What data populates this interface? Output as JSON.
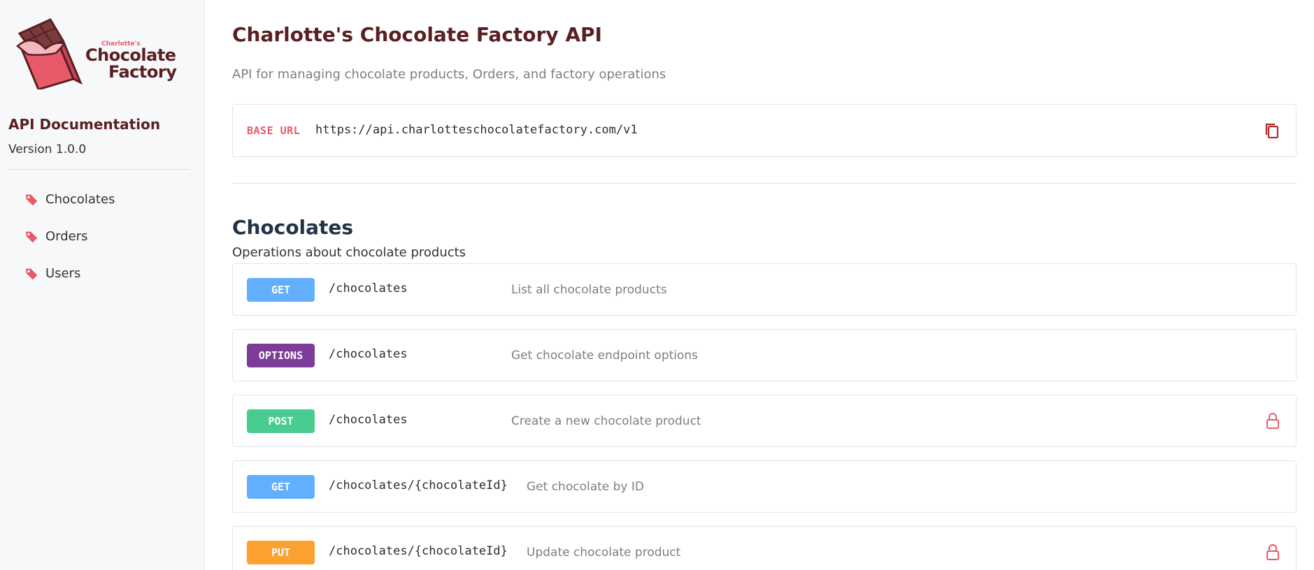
{
  "sidebar": {
    "logo": {
      "small": "Charlotte's",
      "line1": "Chocolate",
      "line2": "Factory"
    },
    "doc_title": "API Documentation",
    "version": "Version 1.0.0",
    "nav": [
      {
        "label": "Chocolates",
        "icon": "tag-icon"
      },
      {
        "label": "Orders",
        "icon": "tag-icon"
      },
      {
        "label": "Users",
        "icon": "tag-icon"
      }
    ]
  },
  "header": {
    "title": "Charlotte's Chocolate Factory API",
    "description": "API for managing chocolate products, Orders, and factory operations"
  },
  "base_url": {
    "label": "BASE URL",
    "value": "https://api.charlotteschocolatefactory.com/v1",
    "copy_icon": "copy-icon"
  },
  "section": {
    "title": "Chocolates",
    "description": "Operations about chocolate products",
    "endpoints": [
      {
        "method": "GET",
        "path": "/chocolates",
        "summary": "List all chocolate products",
        "locked": false
      },
      {
        "method": "OPTIONS",
        "path": "/chocolates",
        "summary": "Get chocolate endpoint options",
        "locked": false
      },
      {
        "method": "POST",
        "path": "/chocolates",
        "summary": "Create a new chocolate product",
        "locked": true
      },
      {
        "method": "GET",
        "path": "/chocolates/{chocolateId}",
        "summary": "Get chocolate by ID",
        "locked": false
      },
      {
        "method": "PUT",
        "path": "/chocolates/{chocolateId}",
        "summary": "Update chocolate product",
        "locked": true
      }
    ]
  },
  "colors": {
    "brand_dark": "#5a1f22",
    "accent": "#e85a6a",
    "get": "#61affe",
    "options": "#7d3c98",
    "post": "#49cc90",
    "put": "#fca130"
  }
}
